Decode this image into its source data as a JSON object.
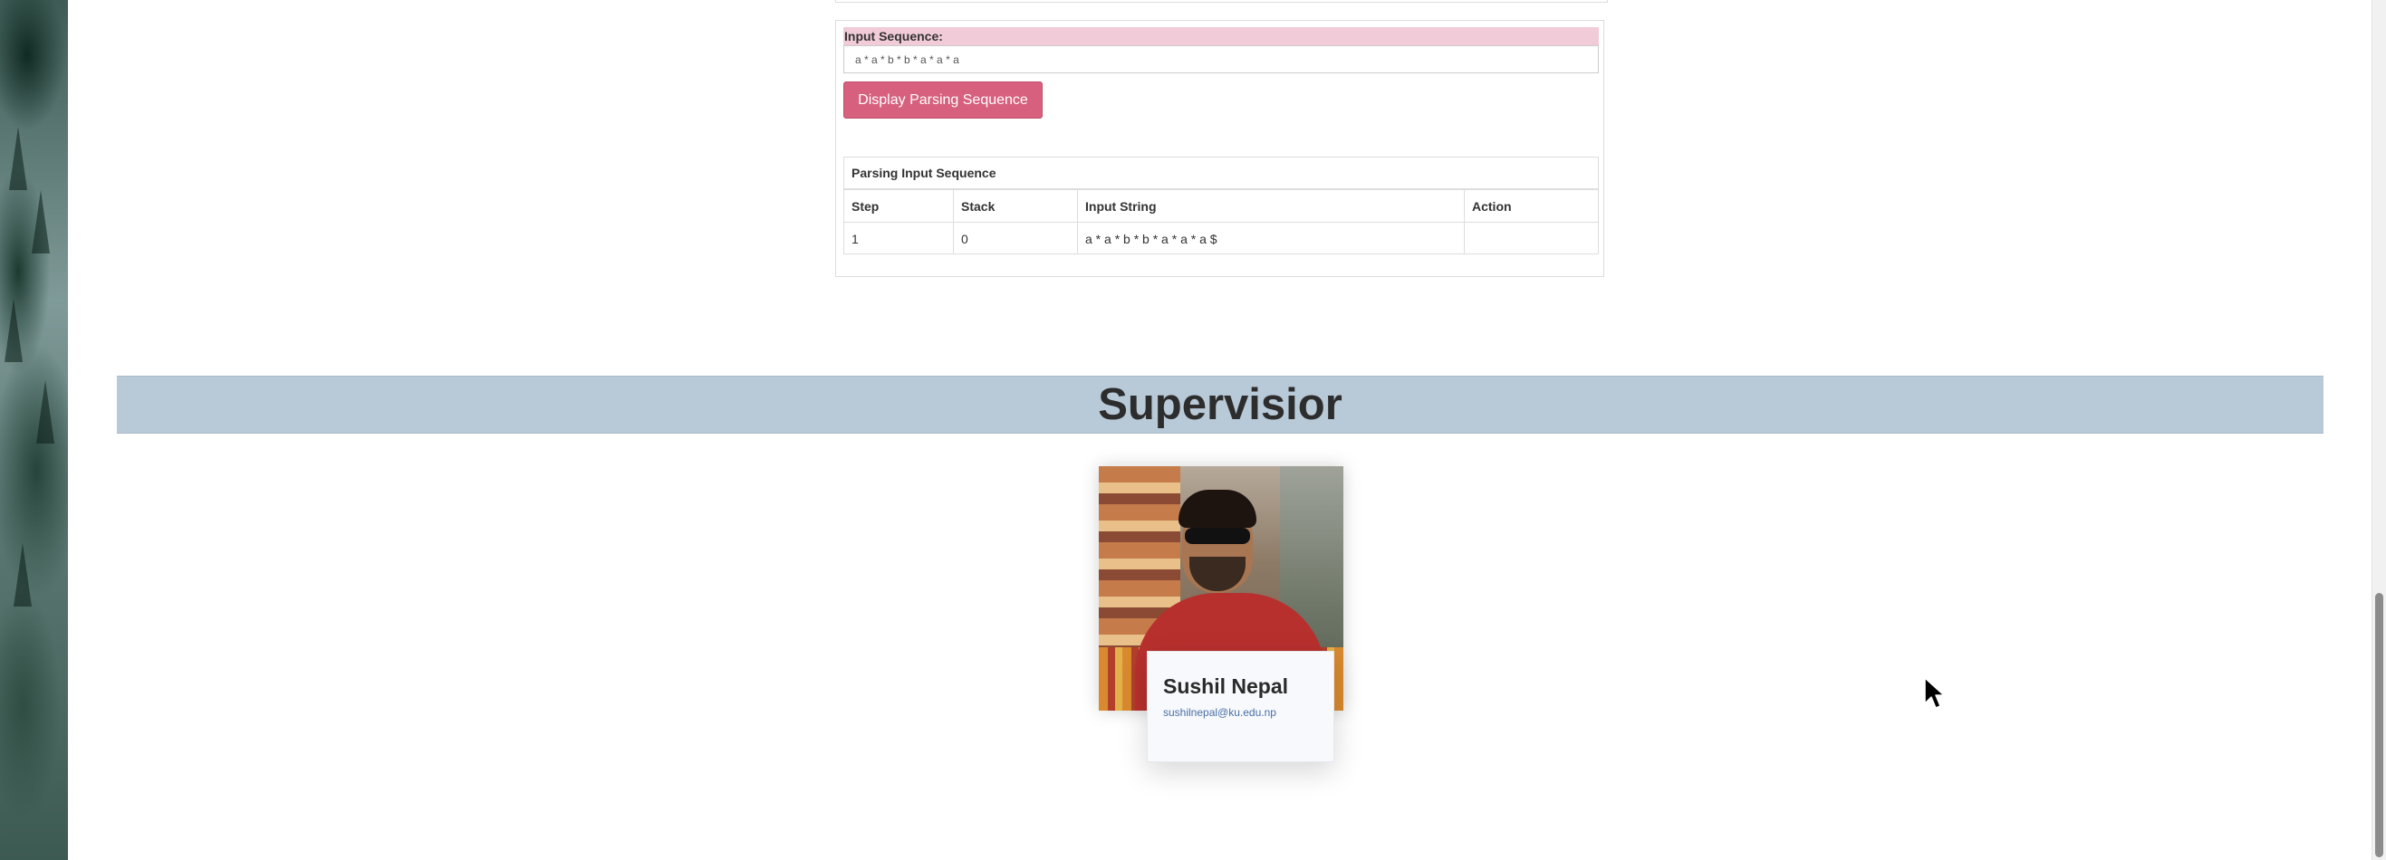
{
  "input_section": {
    "label": "Input Sequence:",
    "value": "a * a * b * b * a * a * a",
    "button_label": "Display Parsing Sequence"
  },
  "parsing_table": {
    "title": "Parsing Input Sequence",
    "headers": {
      "step": "Step",
      "stack": "Stack",
      "input_string": "Input String",
      "action": "Action"
    },
    "rows": [
      {
        "step": "1",
        "stack": "0",
        "input_string": "a * a * b * b * a * a * a $",
        "action": ""
      }
    ]
  },
  "supervisor": {
    "heading": "Supervisior",
    "name": "Sushil Nepal",
    "email": "sushilnepal@ku.edu.np"
  },
  "colors": {
    "button": "#d6607d",
    "label_bg": "#f1ccd8",
    "band_bg": "#b8c9d8",
    "email": "#4a6fa5"
  },
  "icons": {
    "cursor": "mouse-pointer-icon"
  }
}
